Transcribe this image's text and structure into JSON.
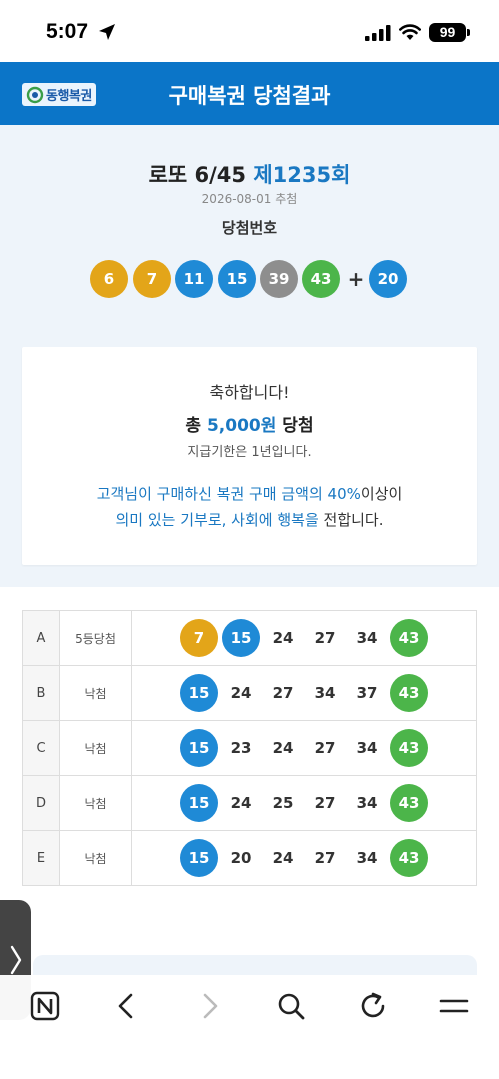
{
  "status_bar": {
    "time": "5:07",
    "battery": "99"
  },
  "header": {
    "logo_text": "동행복권",
    "title": "구매복권 당첨결과"
  },
  "draw": {
    "title_prefix": "로또 6/45 ",
    "round": "제1235회",
    "date": "2026-08-01 추첨",
    "label": "당첨번호",
    "numbers": [
      {
        "value": "6",
        "color": "#e3a519"
      },
      {
        "value": "7",
        "color": "#e3a519"
      },
      {
        "value": "11",
        "color": "#1f8ad6"
      },
      {
        "value": "15",
        "color": "#1f8ad6"
      },
      {
        "value": "39",
        "color": "#8e8e8e"
      },
      {
        "value": "43",
        "color": "#4cb54a"
      }
    ],
    "plus": "+",
    "bonus": {
      "value": "20",
      "color": "#1f8ad6"
    }
  },
  "congrats": {
    "line1": "축하합니다!",
    "total_prefix": "총 ",
    "amount": "5,000원",
    "total_suffix": " 당첨",
    "deadline": "지급기한은 1년입니다.",
    "msg1_a": "고객님이 구매하신 복권 구매 금액의 40%",
    "msg1_b": "이상이",
    "msg2_a": "의미 있는 기부로, 사회에 행복을",
    "msg2_b": " 전합니다."
  },
  "tickets": [
    {
      "game": "A",
      "result": "5등당첨",
      "numbers": [
        {
          "v": "7",
          "hit": "yellow"
        },
        {
          "v": "15",
          "hit": "blue"
        },
        {
          "v": "24",
          "hit": ""
        },
        {
          "v": "27",
          "hit": ""
        },
        {
          "v": "34",
          "hit": ""
        },
        {
          "v": "43",
          "hit": "green"
        }
      ]
    },
    {
      "game": "B",
      "result": "낙첨",
      "numbers": [
        {
          "v": "15",
          "hit": "blue"
        },
        {
          "v": "24",
          "hit": ""
        },
        {
          "v": "27",
          "hit": ""
        },
        {
          "v": "34",
          "hit": ""
        },
        {
          "v": "37",
          "hit": ""
        },
        {
          "v": "43",
          "hit": "green"
        }
      ]
    },
    {
      "game": "C",
      "result": "낙첨",
      "numbers": [
        {
          "v": "15",
          "hit": "blue"
        },
        {
          "v": "23",
          "hit": ""
        },
        {
          "v": "24",
          "hit": ""
        },
        {
          "v": "27",
          "hit": ""
        },
        {
          "v": "34",
          "hit": ""
        },
        {
          "v": "43",
          "hit": "green"
        }
      ]
    },
    {
      "game": "D",
      "result": "낙첨",
      "numbers": [
        {
          "v": "15",
          "hit": "blue"
        },
        {
          "v": "24",
          "hit": ""
        },
        {
          "v": "25",
          "hit": ""
        },
        {
          "v": "27",
          "hit": ""
        },
        {
          "v": "34",
          "hit": ""
        },
        {
          "v": "43",
          "hit": "green"
        }
      ]
    },
    {
      "game": "E",
      "result": "낙첨",
      "numbers": [
        {
          "v": "15",
          "hit": "blue"
        },
        {
          "v": "20",
          "hit": ""
        },
        {
          "v": "24",
          "hit": ""
        },
        {
          "v": "27",
          "hit": ""
        },
        {
          "v": "34",
          "hit": ""
        },
        {
          "v": "43",
          "hit": "green"
        }
      ]
    }
  ],
  "icons": {
    "browser": [
      "n-logo-icon",
      "back-icon",
      "forward-icon",
      "search-icon",
      "reload-icon",
      "menu-icon"
    ],
    "status": [
      "location-arrow-icon",
      "signal-icon",
      "wifi-icon",
      "battery-icon"
    ]
  },
  "colors": {
    "header_bg": "#0b75c8",
    "accent": "#1a78c2",
    "section_bg": "#eef4fa"
  }
}
